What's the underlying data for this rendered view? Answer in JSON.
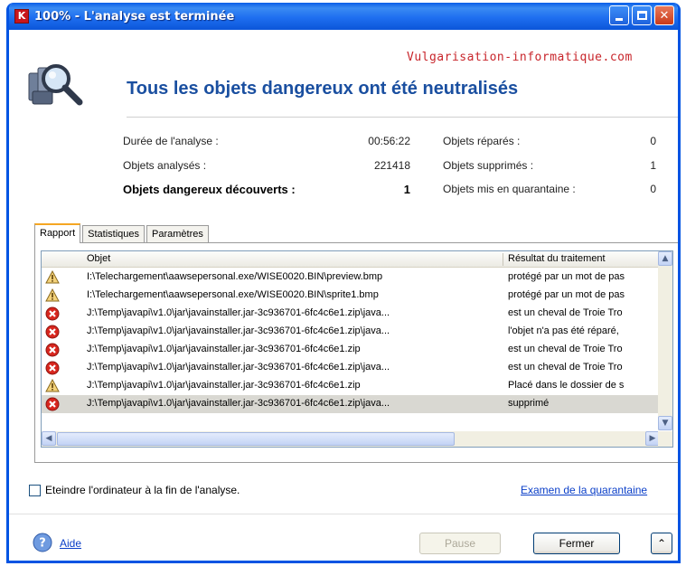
{
  "window": {
    "title": "100% - L'analyse est terminée",
    "app_icon_letter": "K"
  },
  "watermark": "Vulgarisation-informatique.com",
  "headline": "Tous les objets dangereux ont été neutralisés",
  "stats": {
    "duration_label": "Durée de l'analyse :",
    "duration_value": "00:56:22",
    "analyzed_label": "Objets analysés :",
    "analyzed_value": "221418",
    "dangerous_label": "Objets dangereux découverts :",
    "dangerous_value": "1",
    "repaired_label": "Objets réparés :",
    "repaired_value": "0",
    "deleted_label": "Objets supprimés :",
    "deleted_value": "1",
    "quarantine_label": "Objets mis en quarantaine :",
    "quarantine_value": "0"
  },
  "tabs": [
    {
      "label": "Rapport"
    },
    {
      "label": "Statistiques"
    },
    {
      "label": "Paramètres"
    }
  ],
  "table": {
    "headers": {
      "object": "Objet",
      "result": "Résultat du traitement"
    },
    "rows": [
      {
        "icon": "warning-icon",
        "object": "I:\\Telechargement\\aawsepersonal.exe/WISE0020.BIN\\preview.bmp",
        "result": "protégé par un mot de pas"
      },
      {
        "icon": "warning-icon",
        "object": "I:\\Telechargement\\aawsepersonal.exe/WISE0020.BIN\\sprite1.bmp",
        "result": "protégé par un mot de pas"
      },
      {
        "icon": "danger-icon",
        "object": "J:\\Temp\\javapi\\v1.0\\jar\\javainstaller.jar-3c936701-6fc4c6e1.zip\\java...",
        "result": "est un cheval de Troie Tro"
      },
      {
        "icon": "danger-icon",
        "object": "J:\\Temp\\javapi\\v1.0\\jar\\javainstaller.jar-3c936701-6fc4c6e1.zip\\java...",
        "result": "l'objet n'a pas été réparé,"
      },
      {
        "icon": "danger-icon",
        "object": "J:\\Temp\\javapi\\v1.0\\jar\\javainstaller.jar-3c936701-6fc4c6e1.zip",
        "result": "est un cheval de Troie Tro"
      },
      {
        "icon": "danger-icon",
        "object": "J:\\Temp\\javapi\\v1.0\\jar\\javainstaller.jar-3c936701-6fc4c6e1.zip\\java...",
        "result": "est un cheval de Troie Tro"
      },
      {
        "icon": "warning-icon",
        "object": "J:\\Temp\\javapi\\v1.0\\jar\\javainstaller.jar-3c936701-6fc4c6e1.zip",
        "result": "Placé dans le dossier de s"
      },
      {
        "icon": "danger-icon",
        "object": "J:\\Temp\\javapi\\v1.0\\jar\\javainstaller.jar-3c936701-6fc4c6e1.zip\\java...",
        "result": "supprimé",
        "selected": true
      }
    ]
  },
  "shutdown_checkbox": {
    "label": "Eteindre l'ordinateur à la fin de l'analyse.",
    "checked": false
  },
  "quarantine_link": "Examen de la quarantaine",
  "help_link": "Aide",
  "buttons": {
    "pause": "Pause",
    "close": "Fermer"
  },
  "colors": {
    "headline": "#1a4fa0",
    "watermark": "#c8252b",
    "titlebar": "#0a5ee8"
  }
}
